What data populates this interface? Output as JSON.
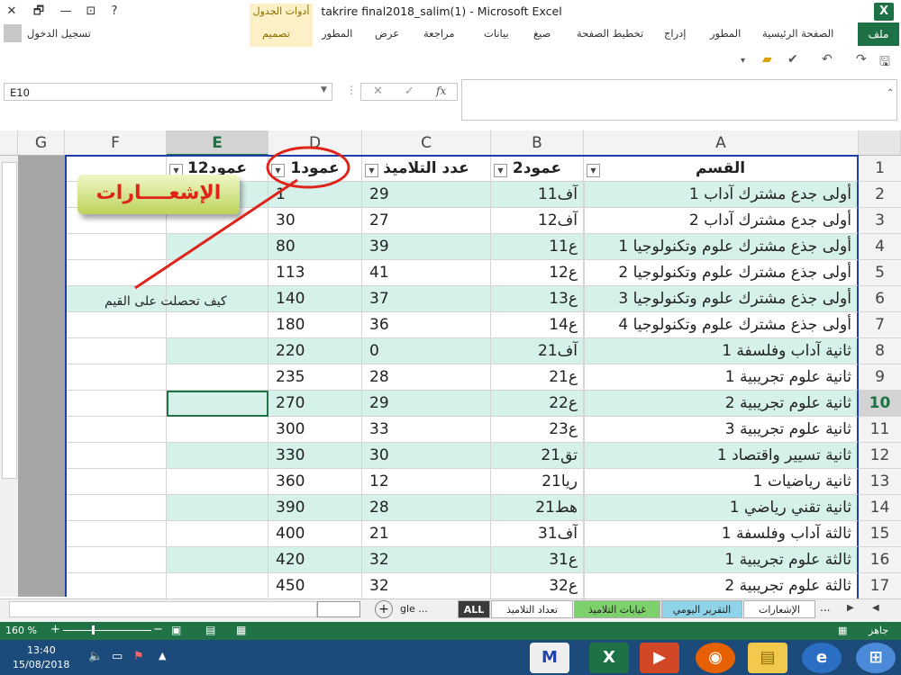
{
  "window": {
    "title": "takrire final2018_salim(1) - Microsoft Excel",
    "context_group": "أدوات الجدول",
    "minimize": "—",
    "restore": "🗗",
    "close": "✕",
    "help": "?"
  },
  "ribbon": {
    "file": "ملف",
    "tabs": [
      "الصفحة الرئيسية",
      "المطور",
      "إدراج",
      "تخطيط الصفحة",
      "صيغ",
      "بيانات",
      "مراجعة",
      "عرض",
      "المطور",
      "تصميم"
    ],
    "login": "تسجيل الدخول"
  },
  "formula_bar": {
    "name_box": "E10",
    "cancel": "✕",
    "enter": "✓",
    "fx": "fx",
    "value": ""
  },
  "columns": [
    "A",
    "B",
    "C",
    "D",
    "E",
    "F",
    "G"
  ],
  "header_row": {
    "A": "القسم",
    "B": "عمود2",
    "C": "عدد التلاميذ",
    "D": "عمود1",
    "E": "عمود12"
  },
  "rows": [
    {
      "n": "1"
    },
    {
      "n": "2",
      "A": "أولى  جدع مشترك آداب  1",
      "B": "1آف1",
      "C": "29",
      "D": "1"
    },
    {
      "n": "3",
      "A": "أولى  جدع مشترك آداب  2",
      "B": "1آف2",
      "C": "27",
      "D": "30"
    },
    {
      "n": "4",
      "A": "أولى  جذع مشترك علوم وتكنولوجيا  1",
      "B": "1ع1",
      "C": "39",
      "D": "80"
    },
    {
      "n": "5",
      "A": "أولى  جذع مشترك علوم وتكنولوجيا  2",
      "B": "1ع2",
      "C": "41",
      "D": "113"
    },
    {
      "n": "6",
      "A": "أولى  جذع مشترك علوم وتكنولوجيا  3",
      "B": "1ع3",
      "C": "37",
      "D": "140"
    },
    {
      "n": "7",
      "A": "أولى  جذع مشترك علوم وتكنولوجيا  4",
      "B": "1ع4",
      "C": "36",
      "D": "180"
    },
    {
      "n": "8",
      "A": "ثانية  آداب وفلسفة  1",
      "B": "2آف1",
      "C": "0",
      "D": "220"
    },
    {
      "n": "9",
      "A": "ثانية  علوم تجريبية  1",
      "B": "2ع1",
      "C": "28",
      "D": "235"
    },
    {
      "n": "10",
      "A": "ثانية  علوم تجريبية  2",
      "B": "2ع2",
      "C": "29",
      "D": "270"
    },
    {
      "n": "11",
      "A": "ثانية  علوم تجريبية  3",
      "B": "2ع3",
      "C": "33",
      "D": "300"
    },
    {
      "n": "12",
      "A": "ثانية  تسيير واقتصاد  1",
      "B": "2تق1",
      "C": "30",
      "D": "330"
    },
    {
      "n": "13",
      "A": "ثانية  رياضيات  1",
      "B": "2ريا1",
      "C": "12",
      "D": "360"
    },
    {
      "n": "14",
      "A": "ثانية  تقني رياضي  1",
      "B": "2هط1",
      "C": "28",
      "D": "390"
    },
    {
      "n": "15",
      "A": "ثالثة  آداب وفلسفة  1",
      "B": "3آف1",
      "C": "21",
      "D": "400"
    },
    {
      "n": "16",
      "A": "ثالثة  علوم تجريبية  1",
      "B": "3ع1",
      "C": "32",
      "D": "420"
    },
    {
      "n": "17",
      "A": "ثالثة  علوم تجريبية  2",
      "B": "3ع2",
      "C": "32",
      "D": "450"
    }
  ],
  "callout": "الإشعــــارات",
  "note": "كيف تحصلت على القيم",
  "sheet_tabs": [
    "الإشعارات",
    "التقرير اليومي",
    "غيابات التلاميذ",
    "تعداد التلاميذ",
    "ALL",
    "gle ..."
  ],
  "sheet_ellipsis": "...",
  "sheet_add": "+",
  "status": {
    "ready": "جاهز",
    "zoom": "160 %"
  },
  "taskbar": {
    "time": "13:40",
    "date": "15/08/2018"
  },
  "colors": {
    "excel_green": "#217346",
    "band": "#d5f1e9",
    "callout_text": "#e0231a"
  }
}
